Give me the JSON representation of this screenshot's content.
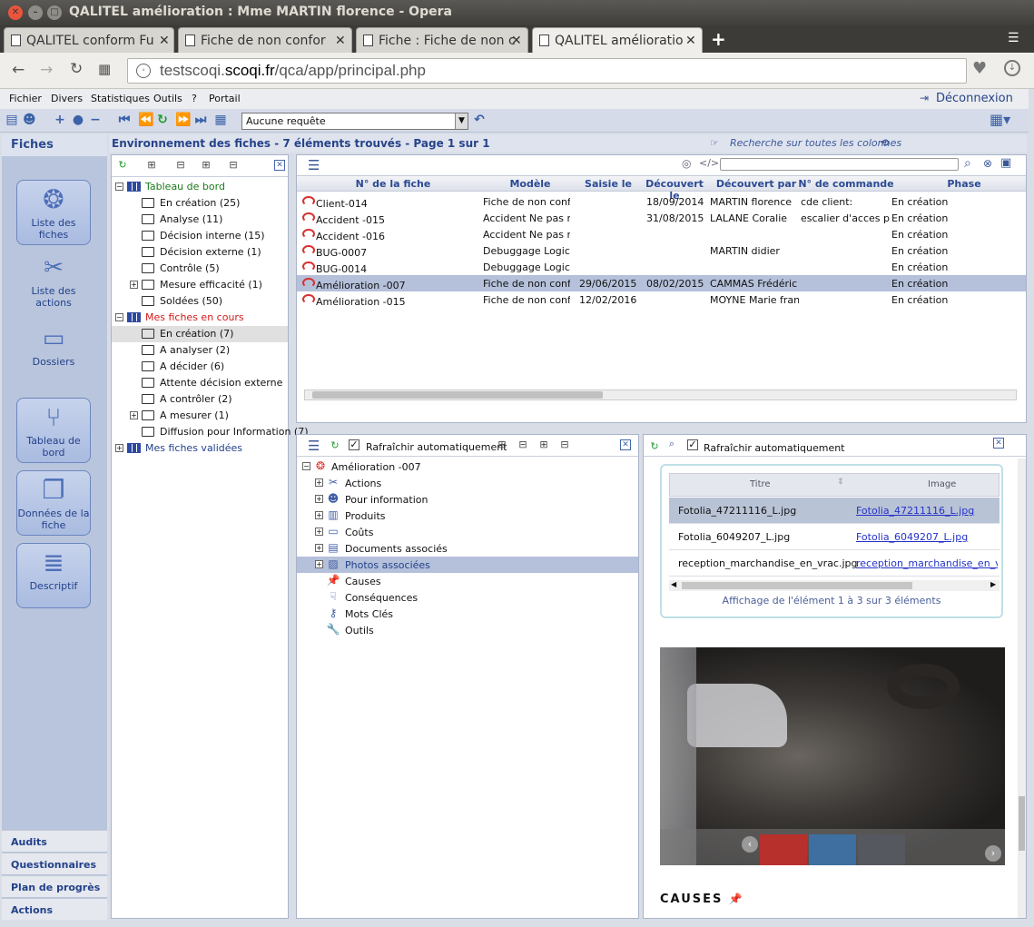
{
  "window": {
    "title": "QALITEL amélioration : Mme MARTIN florence - Opera"
  },
  "tabs": [
    {
      "label": "QALITEL conform Fu"
    },
    {
      "label": "Fiche de non confor"
    },
    {
      "label": "Fiche : Fiche de non c"
    },
    {
      "label": "QALITEL amélioratio"
    }
  ],
  "address": {
    "pre": "testscoqi.",
    "domain": "scoqi.fr",
    "path": "/qca/app/principal.php"
  },
  "menu": {
    "items": [
      "Fichier",
      "Divers",
      "Statistiques",
      "Outils",
      "?",
      "Portail"
    ],
    "logout": "Déconnexion"
  },
  "toolbar": {
    "request_value": "Aucune requête"
  },
  "sidebar": {
    "title": "Fiches",
    "buttons": [
      "Liste des fiches",
      "Liste des actions",
      "Dossiers",
      "Tableau de bord",
      "Données de la fiche",
      "Descriptif"
    ],
    "bottom": [
      "Audits",
      "Questionnaires",
      "Plan de progrès",
      "Actions"
    ]
  },
  "header": {
    "title": "Environnement des fiches - 7 éléments trouvés - Page 1 sur 1",
    "search_all": "Recherche sur toutes les colonnes"
  },
  "tree": {
    "dashboard": "Tableau de bord",
    "dashboard_items": [
      "En création (25)",
      "Analyse (11)",
      "Décision interne (15)",
      "Décision externe (1)",
      "Contrôle (5)",
      "Mesure efficacité (1)",
      "Soldées (50)"
    ],
    "mine": "Mes fiches en cours",
    "mine_items": [
      "En création (7)",
      "A analyser (2)",
      "A décider (6)",
      "Attente décision externe",
      "A contrôler (2)",
      "A mesurer (1)",
      "Diffusion pour Information (7)"
    ],
    "validated": "Mes fiches validées"
  },
  "grid": {
    "columns": [
      "N° de la fiche",
      "Modèle",
      "Saisie le",
      "Découvert le",
      "Découvert par",
      "N° de commande",
      "Phase"
    ],
    "rows": [
      [
        "Client-014",
        "Fiche de non confor",
        "",
        "18/09/2014",
        "MARTIN florence",
        "cde client:",
        "En création"
      ],
      [
        "Accident -015",
        "Accident Ne pas mo",
        "",
        "31/08/2015",
        "LALANE Coralie",
        "escalier d'acces prin",
        "En création"
      ],
      [
        "Accident -016",
        "Accident Ne pas mo",
        "",
        "",
        "",
        "",
        "En création"
      ],
      [
        "BUG-0007",
        "Debuggage Logiciel",
        "",
        "",
        "MARTIN didier",
        "",
        "En création"
      ],
      [
        "BUG-0014",
        "Debuggage Logiciel",
        "",
        "",
        "",
        "",
        "En création"
      ],
      [
        "Amélioration -007",
        "Fiche de non confor",
        "29/06/2015",
        "08/02/2015",
        "CAMMAS Frédéric",
        "",
        "En création"
      ],
      [
        "Amélioration -015",
        "Fiche de non confor",
        "12/02/2016",
        "",
        "MOYNE Marie franc",
        "",
        "En création"
      ]
    ]
  },
  "detail_tree": {
    "refresh_label": "Rafraîchir automatiquement",
    "root": "Amélioration -007",
    "nodes": [
      "Actions",
      "Pour information",
      "Produits",
      "Coûts",
      "Documents associés",
      "Photos associées",
      "Causes",
      "Conséquences",
      "Mots Clés",
      "Outils"
    ]
  },
  "photos": {
    "refresh_label": "Rafraîchir automatiquement",
    "columns": [
      "Titre",
      "Image"
    ],
    "rows": [
      {
        "title": "Fotolia_47211116_L.jpg",
        "image": "Fotolia_47211116_L.jpg"
      },
      {
        "title": "Fotolia_6049207_L.jpg",
        "image": "Fotolia_6049207_L.jpg"
      },
      {
        "title": "reception_marchandise_en_vrac.jpg",
        "image": "reception_marchandise_en_vrac"
      }
    ],
    "footer": "Affichage de l'élément 1 à 3 sur 3 éléments",
    "section_title": "CAUSES"
  },
  "colors": {
    "accent": "#2c4a8d",
    "selected_row": "#b5c1da",
    "red_text": "#d41a1a",
    "green_text": "#1a7a1a"
  }
}
